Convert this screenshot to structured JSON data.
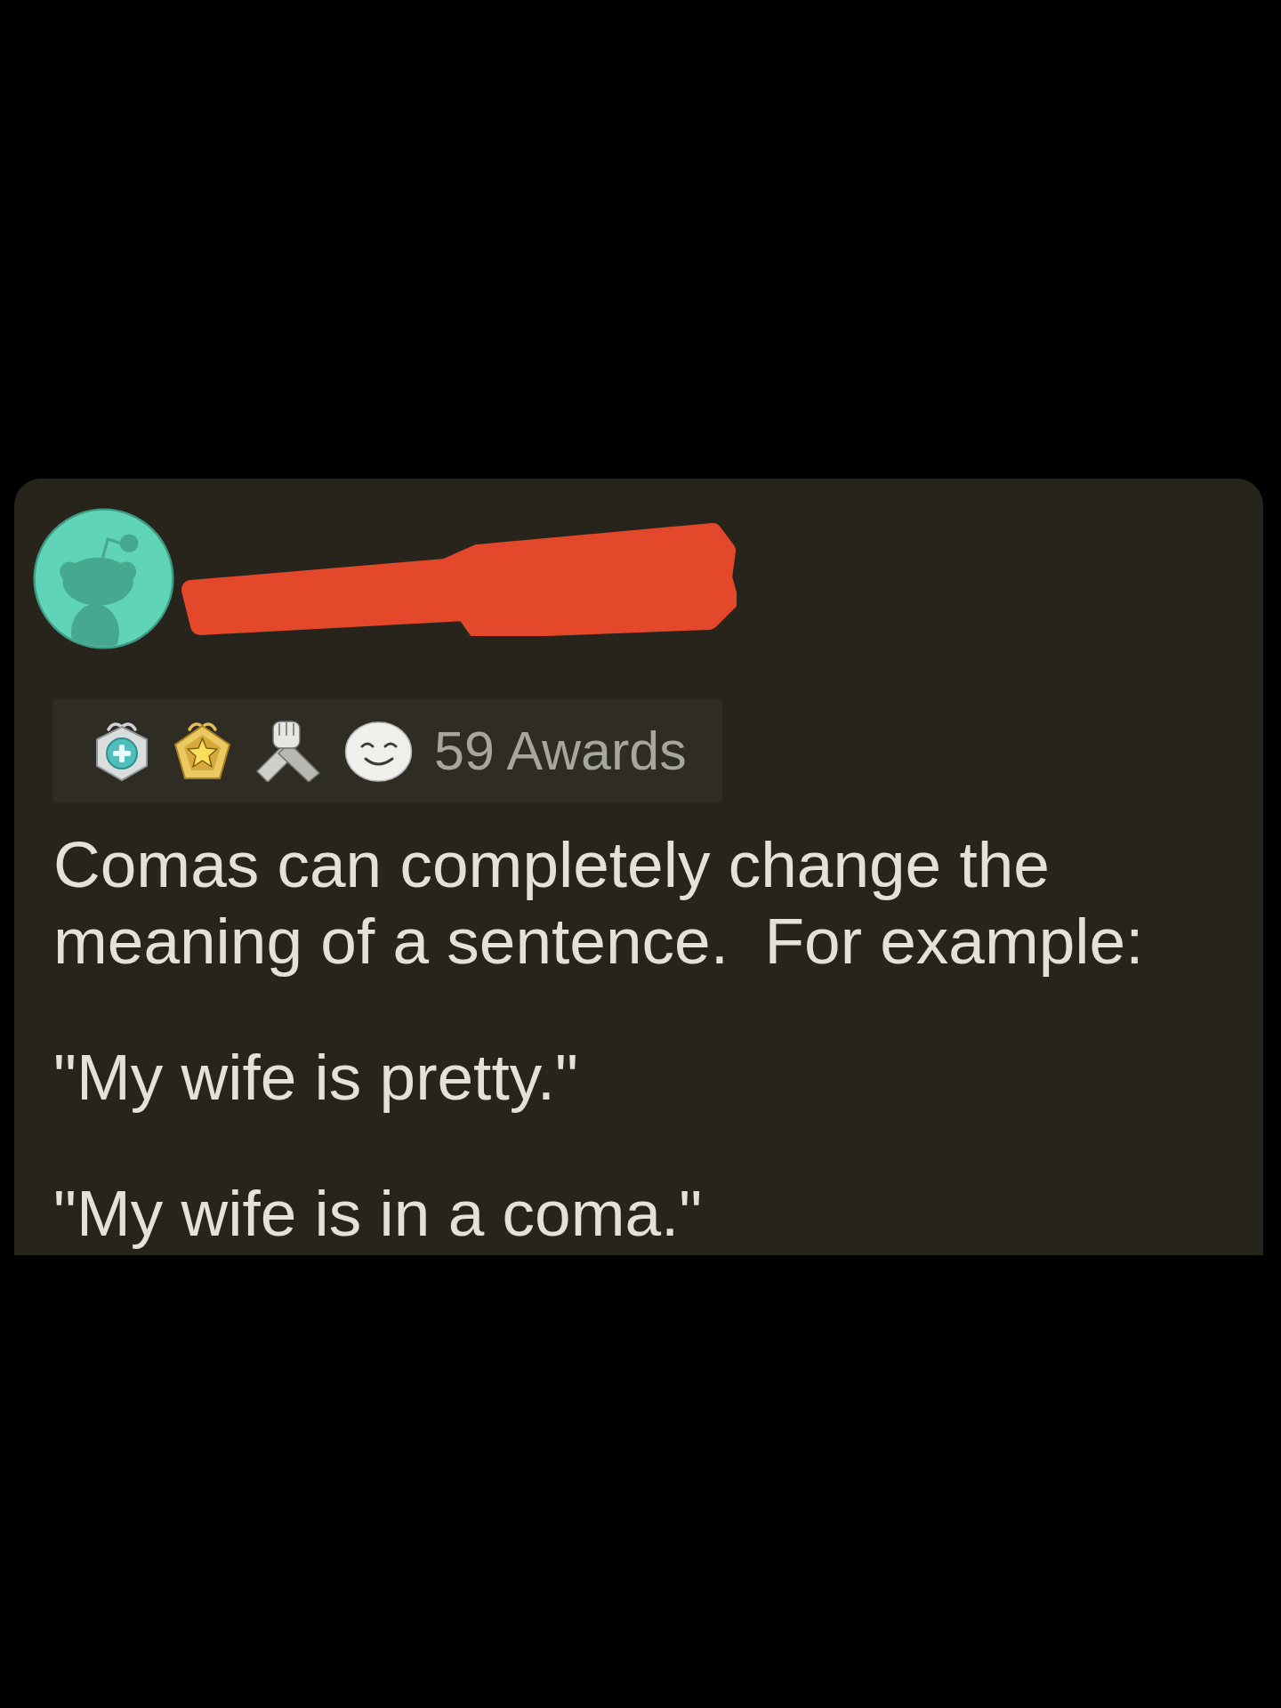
{
  "post": {
    "author": {
      "name_redacted": true
    },
    "awards": {
      "label": "59 Awards"
    },
    "body": [
      "Comas can completely change the meaning of a sentence.  For example:",
      "\"My wife is pretty.\"",
      "\"My wife is in a coma.\""
    ]
  }
}
